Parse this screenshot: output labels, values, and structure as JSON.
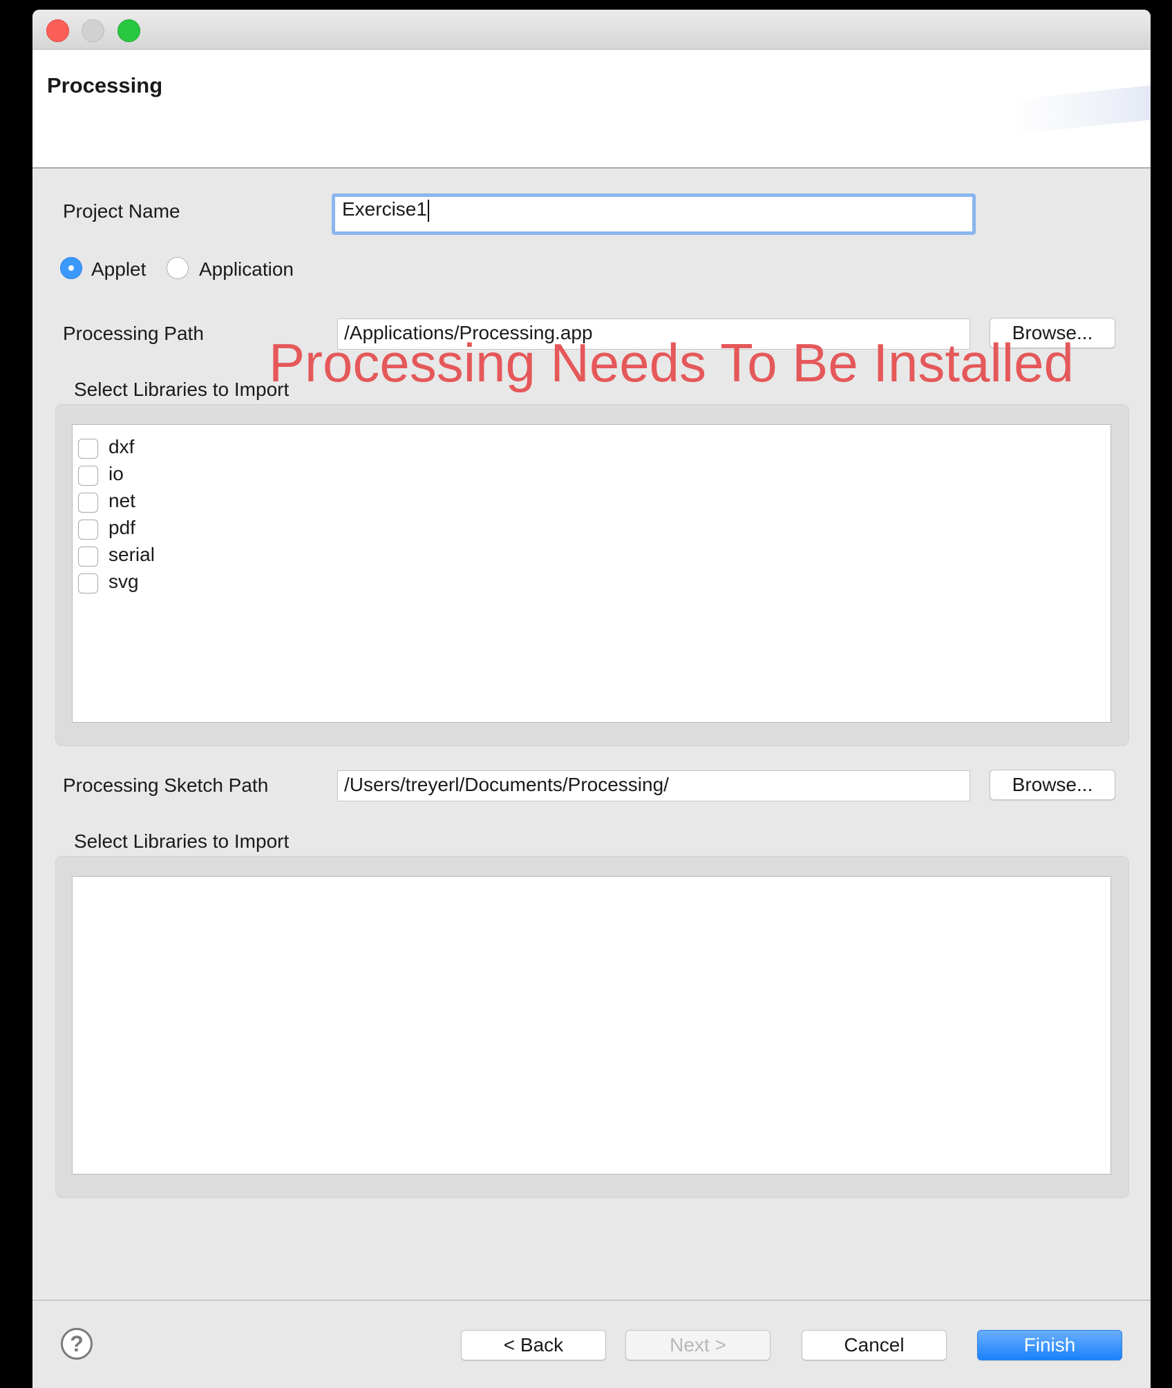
{
  "banner": {
    "title": "Processing"
  },
  "project": {
    "label": "Project Name",
    "value": "Exercise1"
  },
  "type_options": [
    {
      "label": "Applet",
      "checked": true
    },
    {
      "label": "Application",
      "checked": false
    }
  ],
  "processing_path": {
    "label": "Processing Path",
    "value": "/Applications/Processing.app",
    "browse_label": "Browse..."
  },
  "warning": "Processing Needs To Be Installed",
  "libraries_1": {
    "label": "Select Libraries to Import",
    "items": [
      "dxf",
      "io",
      "net",
      "pdf",
      "serial",
      "svg"
    ]
  },
  "sketch_path": {
    "label": "Processing Sketch Path",
    "value": "/Users/treyerl/Documents/Processing/",
    "browse_label": "Browse..."
  },
  "libraries_2": {
    "label": "Select Libraries to Import"
  },
  "footer": {
    "help_icon": "?",
    "back": "< Back",
    "next": "Next >",
    "cancel": "Cancel",
    "finish": "Finish"
  },
  "colors": {
    "accent": "#1a82fb",
    "warning": "#e5585a"
  }
}
